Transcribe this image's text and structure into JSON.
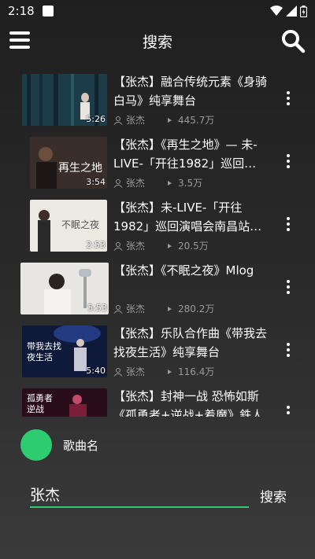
{
  "status": {
    "time": "2:18"
  },
  "header": {
    "title": "搜索"
  },
  "videos": [
    {
      "title": "【张杰】融合传统元素《身骑白马》纯享舞台",
      "duration": "5:26",
      "artist": "张杰",
      "plays": "445.7万"
    },
    {
      "title": "【张杰】《再生之地》— 未-LIVE-「开往1982」巡回演…",
      "duration": "3:54",
      "artist": "张杰",
      "plays": "3.5万"
    },
    {
      "title": "【张杰】未-LIVE-「开往1982」巡回演唱会南昌站…",
      "duration": "2:53",
      "artist": "张杰",
      "plays": "20.5万"
    },
    {
      "title": "【张杰】《不眠之夜》Mlog",
      "duration": "5:53",
      "artist": "张杰",
      "plays": "280.2万"
    },
    {
      "title": "【张杰】乐队合作曲《带我去找夜生活》纯享舞台",
      "duration": "5:40",
      "artist": "张杰",
      "plays": "116.4万"
    },
    {
      "title": "【张杰】封神一战 恐怖如斯《孤勇者+逆战+着魔》鉄人",
      "duration": "",
      "artist": "",
      "plays": ""
    }
  ],
  "player": {
    "song_name": "歌曲名"
  },
  "search": {
    "query": "张杰",
    "button": "搜索"
  },
  "colors": {
    "accent": "#2ecc71",
    "meta": "#9a9a9a"
  }
}
